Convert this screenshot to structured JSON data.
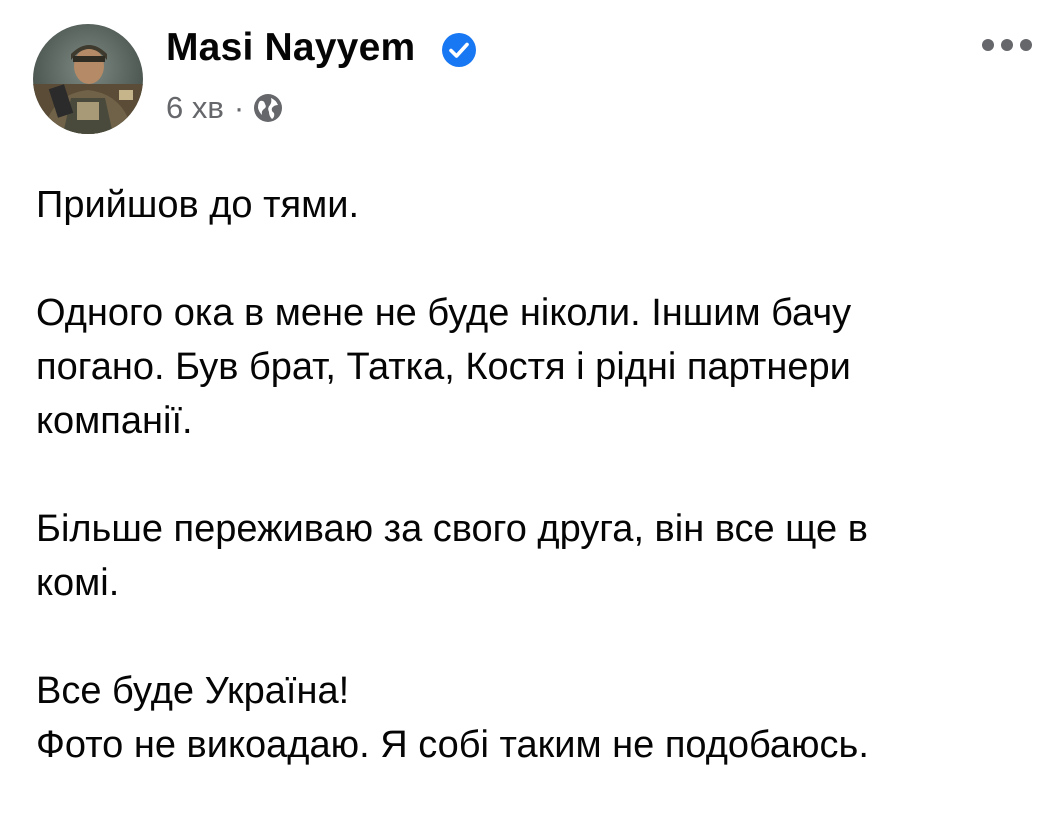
{
  "post": {
    "author": "Masi Nayyem",
    "verified_icon": "verified-badge-icon",
    "time": "6 хв",
    "separator": "·",
    "audience_icon": "globe-icon",
    "more_icon": "more-options-icon",
    "paragraphs": [
      [
        "Прийшов до тями."
      ],
      [
        "Одного ока в мене не буде ніколи. Іншим бачу",
        "погано. Був брат, Татка, Костя і рідні партнери",
        "компанії."
      ],
      [
        "Більше переживаю за свого друга, він все ще в",
        "комі."
      ],
      [
        "Все буде Україна!",
        "Фото не викоадаю. Я собі таким не подобаюсь."
      ]
    ]
  },
  "colors": {
    "text": "#050505",
    "meta": "#65676b",
    "verified": "#1877f2"
  }
}
